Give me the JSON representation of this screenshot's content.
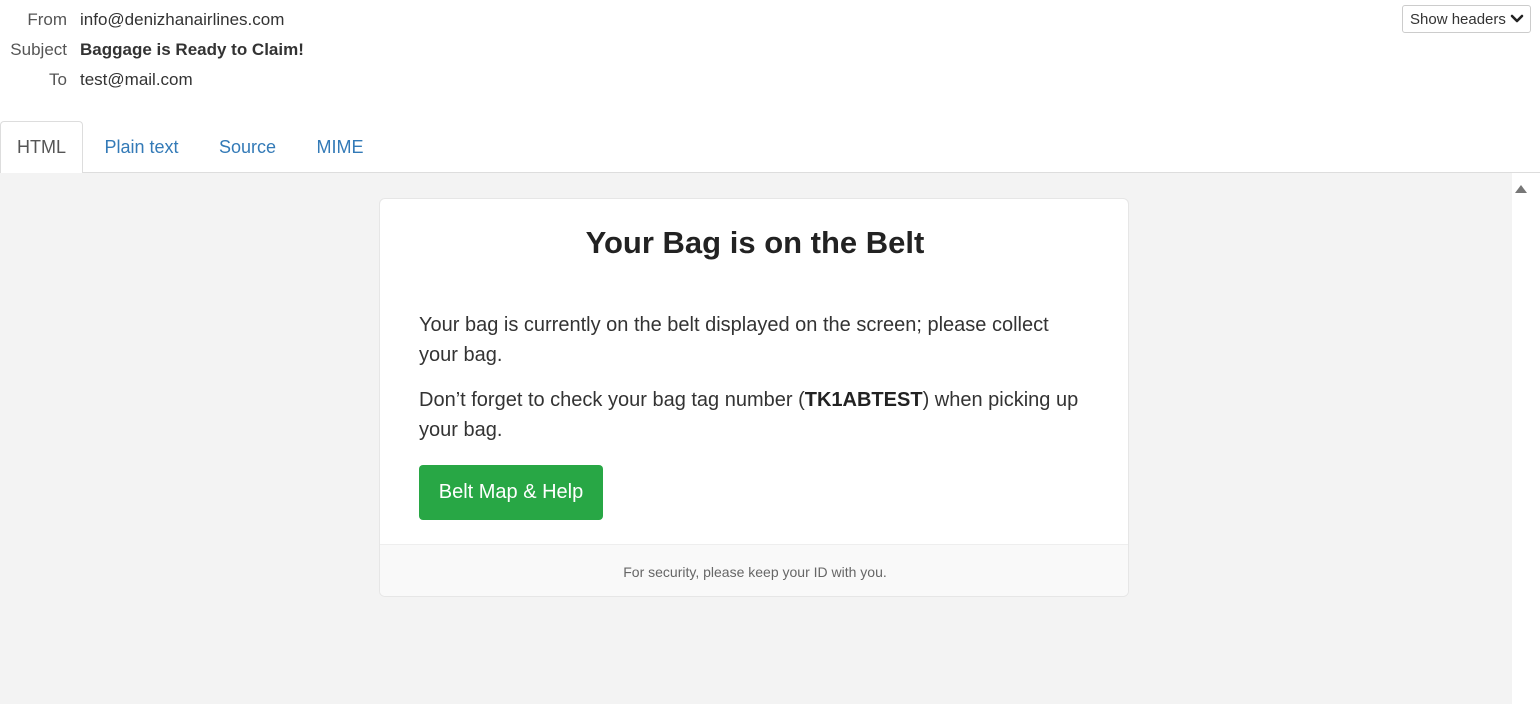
{
  "headers": {
    "from_label": "From",
    "from_value": "info@denizhanairlines.com",
    "subject_label": "Subject",
    "subject_value": "Baggage is Ready to Claim!",
    "to_label": "To",
    "to_value": "test@mail.com",
    "show_headers_label": "Show headers",
    "show_headers_icon": "chevron-down-icon"
  },
  "tabs": [
    {
      "label": "HTML",
      "active": true
    },
    {
      "label": "Plain text",
      "active": false
    },
    {
      "label": "Source",
      "active": false
    },
    {
      "label": "MIME",
      "active": false
    }
  ],
  "email": {
    "title": "Your Bag is on the Belt",
    "paragraph1": "Your bag is currently on the belt displayed on the screen; please collect your bag.",
    "paragraph2_prefix": "Don’t forget to check your bag tag number (",
    "bag_tag": "TK1ABTEST",
    "paragraph2_suffix": ") when picking up your bag.",
    "button_label": "Belt Map & Help",
    "footer": "For security, please keep your ID with you."
  },
  "colors": {
    "link": "#337ab7",
    "button_bg": "#28a745",
    "viewer_bg": "#f3f3f3"
  },
  "scrollbar": {
    "icon": "scroll-up-arrow-icon"
  }
}
